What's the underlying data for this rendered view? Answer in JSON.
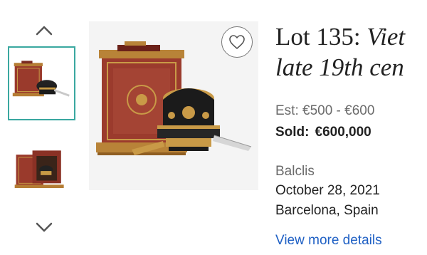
{
  "gallery": {
    "up_icon": "chevron-up-icon",
    "down_icon": "chevron-down-icon",
    "favorite_icon": "heart-icon",
    "selected_border_color": "#3aa8a0"
  },
  "lot": {
    "prefix": "Lot 135:",
    "title_part1": "Viet",
    "title_line2": "late 19th cen",
    "estimate": "Est: €500 - €600",
    "sold_label": "Sold:",
    "sold_amount": "€600,000",
    "auction_house": "Balclis",
    "date": "October 28, 2021",
    "location": "Barcelona, Spain",
    "more_link": "View more details",
    "link_color": "#1f60c4"
  }
}
